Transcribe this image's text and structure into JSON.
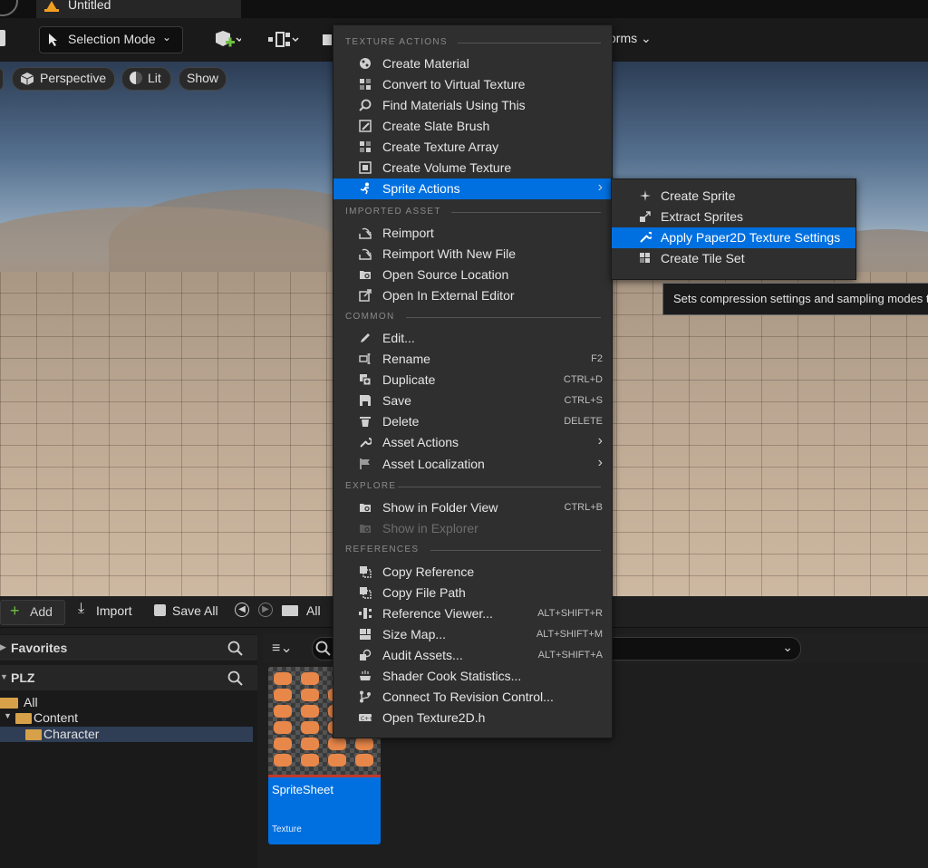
{
  "window": {
    "tab_title": "Untitled"
  },
  "toolbar": {
    "selection_mode": "Selection Mode",
    "transforms_partial": "orms"
  },
  "viewport": {
    "perspective": "Perspective",
    "lit": "Lit",
    "show": "Show"
  },
  "content_browser": {
    "add": "Add",
    "import": "Import",
    "save_all": "Save All",
    "path_all": "All",
    "favorites": "Favorites",
    "project": "PLZ",
    "tree": [
      "All",
      "Content",
      "Character"
    ],
    "asset": {
      "name": "SpriteSheet",
      "type": "Texture"
    }
  },
  "context_menu": {
    "sections": {
      "texture_actions": "TEXTURE ACTIONS",
      "imported_asset": "IMPORTED ASSET",
      "common": "COMMON",
      "explore": "EXPLORE",
      "references": "REFERENCES"
    },
    "items": {
      "create_material": "Create Material",
      "convert_virtual": "Convert to Virtual Texture",
      "find_materials": "Find Materials Using This",
      "create_slate_brush": "Create Slate Brush",
      "create_texture_array": "Create Texture Array",
      "create_volume_texture": "Create Volume Texture",
      "sprite_actions": "Sprite Actions",
      "reimport": "Reimport",
      "reimport_new_file": "Reimport With New File",
      "open_source_location": "Open Source Location",
      "open_external_editor": "Open In External Editor",
      "edit": "Edit...",
      "rename": "Rename",
      "duplicate": "Duplicate",
      "save": "Save",
      "delete": "Delete",
      "asset_actions": "Asset Actions",
      "asset_localization": "Asset Localization",
      "show_folder_view": "Show in Folder View",
      "show_explorer": "Show in Explorer",
      "copy_reference": "Copy Reference",
      "copy_file_path": "Copy File Path",
      "reference_viewer": "Reference Viewer...",
      "size_map": "Size Map...",
      "audit_assets": "Audit Assets...",
      "shader_cook": "Shader Cook Statistics...",
      "connect_revision": "Connect To Revision Control...",
      "open_header": "Open Texture2D.h"
    },
    "shortcuts": {
      "rename": "F2",
      "duplicate": "CTRL+D",
      "save": "CTRL+S",
      "delete": "DELETE",
      "show_folder_view": "CTRL+B",
      "reference_viewer": "ALT+SHIFT+R",
      "size_map": "ALT+SHIFT+M",
      "audit_assets": "ALT+SHIFT+A"
    }
  },
  "sub_menu": {
    "create_sprite": "Create Sprite",
    "extract_sprites": "Extract Sprites",
    "apply_paper2d": "Apply Paper2D Texture Settings",
    "create_tile_set": "Create Tile Set"
  },
  "tooltip": {
    "text": "Sets compression settings and sampling modes t"
  },
  "colors": {
    "highlight": "#0070e0",
    "menu_bg": "#2f2f2f",
    "asset_tile": "#0070e0"
  }
}
